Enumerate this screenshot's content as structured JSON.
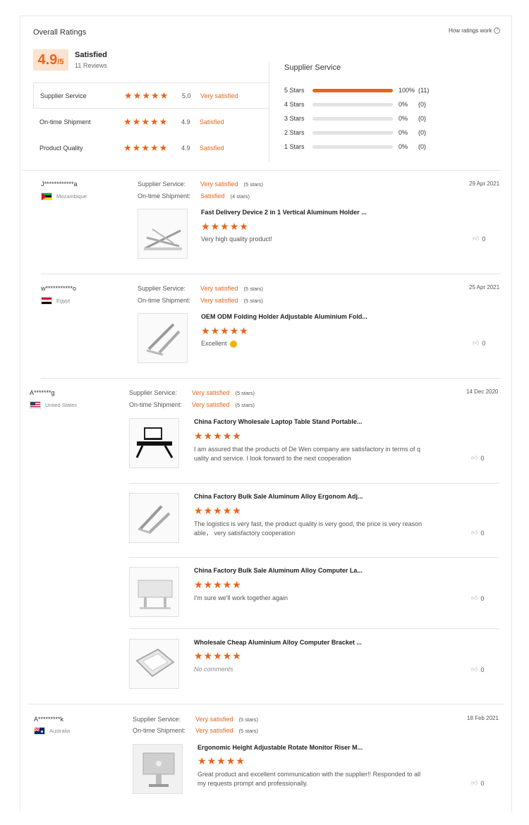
{
  "header": {
    "title": "Overall Ratings",
    "how_link": "How ratings work",
    "score": "4.9",
    "score_suffix": "/5",
    "label": "Satisfied",
    "reviews": "11 Reviews"
  },
  "sub_ratings": [
    {
      "label": "Supplier Service",
      "score": "5.0",
      "text": "Very satisfied",
      "stars": 5
    },
    {
      "label": "On-time Shipment",
      "score": "4.9",
      "text": "Satisfied",
      "stars": 5
    },
    {
      "label": "Product Quality",
      "score": "4.9",
      "text": "Satisfied",
      "stars": 5
    }
  ],
  "breakdown": {
    "title": "Supplier Service",
    "rows": [
      {
        "label": "5  Stars",
        "pct": "100%",
        "count": "(11)",
        "fill": 1.0
      },
      {
        "label": "4  Stars",
        "pct": "0%",
        "count": "(0)",
        "fill": 0
      },
      {
        "label": "3  Stars",
        "pct": "0%",
        "count": "(0)",
        "fill": 0
      },
      {
        "label": "2  Stars",
        "pct": "0%",
        "count": "(0)",
        "fill": 0
      },
      {
        "label": "1  Stars",
        "pct": "0%",
        "count": "(0)",
        "fill": 0
      }
    ]
  },
  "meta_labels": {
    "service": "Supplier Service:",
    "shipment": "On-time Shipment:"
  },
  "reviews": [
    {
      "name": "J************a",
      "country": "Mozambique",
      "date": "29 Apr 2021",
      "service": "Very satisfied",
      "service_stars": "(5 stars)",
      "shipment": "Satisfied",
      "shipment_stars": "(4 stars)",
      "items": [
        {
          "title": "Fast Delivery Device 2 in 1 Vertical Aluminum Holder ...",
          "comment": "Very high quality product!",
          "likes": "0",
          "stars": 5
        }
      ]
    },
    {
      "name": "w***********o",
      "country": "Egypt",
      "date": "25 Apr 2021",
      "service": "Very satisfied",
      "service_stars": "(5 stars)",
      "shipment": "Very satisfied",
      "shipment_stars": "(5 stars)",
      "items": [
        {
          "title": "OEM ODM Folding Holder Adjustable Aluminium Fold...",
          "comment": "Excellent",
          "likes": "0",
          "stars": 5
        }
      ]
    },
    {
      "name": "A*******g",
      "country": "United States",
      "date": "14 Dec 2020",
      "service": "Very satisfied",
      "service_stars": "(5 stars)",
      "shipment": "Very satisfied",
      "shipment_stars": "(5 stars)",
      "items": [
        {
          "title": "China Factory Wholesale Laptop Table Stand Portable...",
          "comment_lines": [
            "I am assured that the products of De Wen company are satisfactory in terms of q",
            "uality and service. I look forward to the next cooperation"
          ],
          "likes": "0",
          "stars": 5
        },
        {
          "title": "China Factory Bulk Sale Aluminum Alloy Ergonom Adj...",
          "comment_lines": [
            "The logistics is very fast, the product quality is very good, the price is very reason",
            "able， very satisfactory cooperation"
          ],
          "likes": "0",
          "stars": 5
        },
        {
          "title": "China Factory Bulk Sale Aluminum Alloy Computer La...",
          "comment": "I'm sure we'll work together again",
          "likes": "0",
          "stars": 5
        },
        {
          "title": "Wholesale Cheap Aluminium Alloy Computer Bracket ...",
          "comment": "No comments",
          "likes": "0",
          "stars": 5
        }
      ]
    },
    {
      "name": "A*********k",
      "country": "Australia",
      "date": "18 Feb 2021",
      "service": "Very satisfied",
      "service_stars": "(5 stars)",
      "shipment": "Very satisfied",
      "shipment_stars": "(5 stars)",
      "items": [
        {
          "title": "Ergonomic Height Adjustable Rotate Monitor Riser M...",
          "comment_lines": [
            "Great product and excellent communication with the supplier!! Responded to all",
            "my requests prompt and professionally."
          ],
          "likes": "0",
          "stars": 5
        }
      ]
    }
  ],
  "colors": {
    "accent": "#e8641b",
    "accent_bg": "#fbe3cf"
  }
}
